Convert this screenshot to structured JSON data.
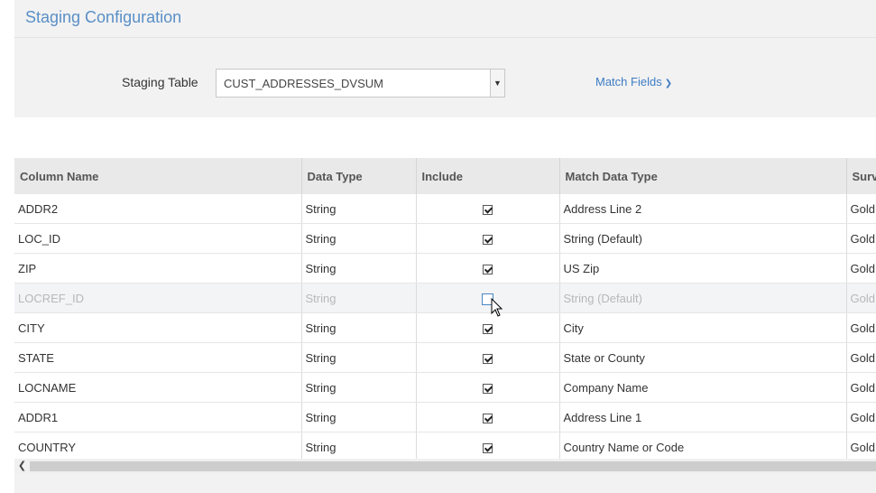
{
  "header": {
    "title": "Staging Configuration"
  },
  "config": {
    "staging_label": "Staging Table",
    "staging_value": "CUST_ADDRESSES_DVSUM",
    "match_fields_label": "Match Fields"
  },
  "table": {
    "columns": [
      "Column Name",
      "Data Type",
      "Include",
      "Match Data Type",
      "Surv"
    ],
    "rows": [
      {
        "name": "ADDR2",
        "type": "String",
        "include": true,
        "match": "Address Line 2",
        "surv": "Gold"
      },
      {
        "name": "LOC_ID",
        "type": "String",
        "include": true,
        "match": "String (Default)",
        "surv": "Gold"
      },
      {
        "name": "ZIP",
        "type": "String",
        "include": true,
        "match": "US Zip",
        "surv": "Gold"
      },
      {
        "name": "LOCREF_ID",
        "type": "String",
        "include": false,
        "match": "String (Default)",
        "surv": "Gold"
      },
      {
        "name": "CITY",
        "type": "String",
        "include": true,
        "match": "City",
        "surv": "Gold"
      },
      {
        "name": "STATE",
        "type": "String",
        "include": true,
        "match": "State or County",
        "surv": "Gold"
      },
      {
        "name": "LOCNAME",
        "type": "String",
        "include": true,
        "match": "Company Name",
        "surv": "Gold"
      },
      {
        "name": "ADDR1",
        "type": "String",
        "include": true,
        "match": "Address Line 1",
        "surv": "Gold"
      },
      {
        "name": "COUNTRY",
        "type": "String",
        "include": true,
        "match": "Country Name or Code",
        "surv": "Gold"
      }
    ]
  },
  "icons": {
    "dropdown": "chevron-down-icon",
    "scroll_left": "chevron-left-icon",
    "cursor": "mouse-pointer-icon"
  },
  "colors": {
    "accent": "#3d7cc4",
    "title": "#5a8fc7"
  }
}
